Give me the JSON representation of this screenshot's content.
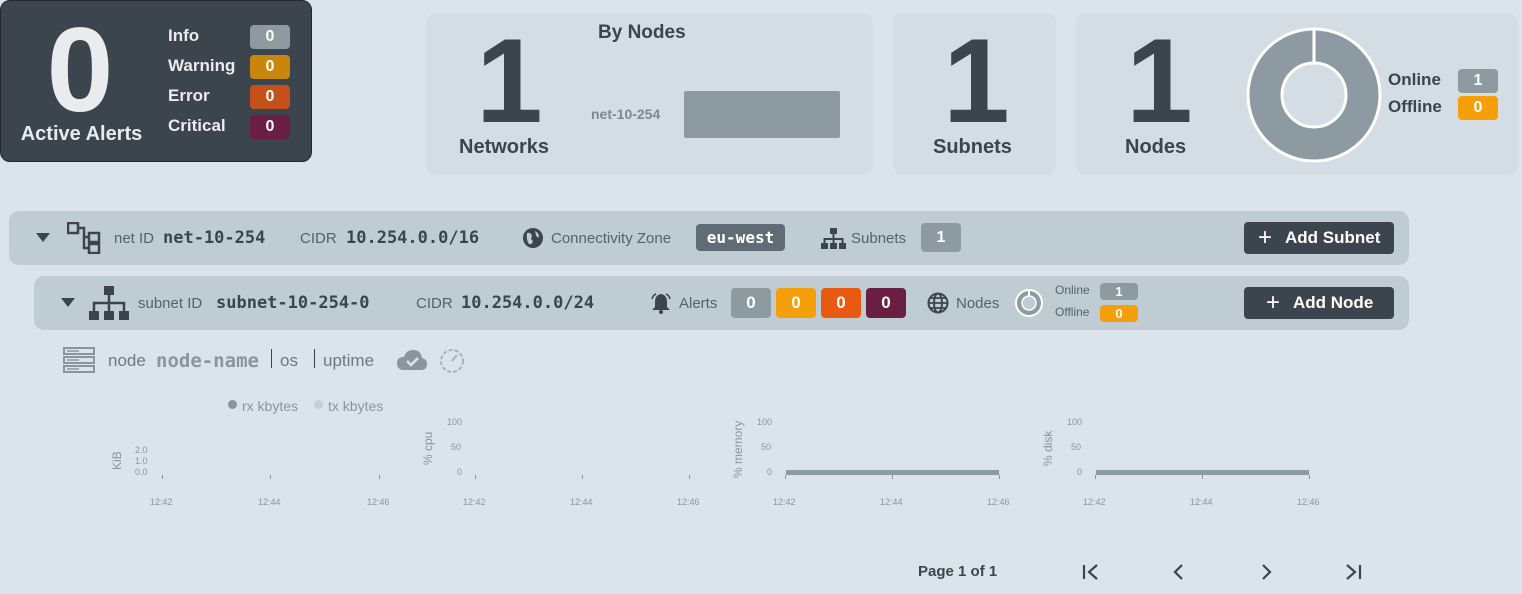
{
  "alerts": {
    "count": "0",
    "label": "Active Alerts",
    "severities": [
      {
        "label": "Info",
        "value": "0",
        "color": "#8d9aa2"
      },
      {
        "label": "Warning",
        "value": "0",
        "color": "#c8860c"
      },
      {
        "label": "Error",
        "value": "0",
        "color": "#c4501a"
      },
      {
        "label": "Critical",
        "value": "0",
        "color": "#6a1e42"
      }
    ]
  },
  "networks": {
    "count": "1",
    "label": "Networks",
    "chart_title": "By Nodes",
    "chart_data": {
      "type": "bar",
      "title": "By Nodes",
      "categories": [
        "net-10-254"
      ],
      "values": [
        1
      ],
      "orientation": "horizontal"
    }
  },
  "subnets": {
    "count": "1",
    "label": "Subnets"
  },
  "nodes": {
    "count": "1",
    "label": "Nodes",
    "online_label": "Online",
    "online_value": "1",
    "offline_label": "Offline",
    "offline_value": "0",
    "chart_data": {
      "type": "pie",
      "categories": [
        "Online",
        "Offline"
      ],
      "values": [
        1,
        0
      ]
    }
  },
  "network_row": {
    "id_label": "net ID",
    "id_value": "net-10-254",
    "cidr_label": "CIDR",
    "cidr_value": "10.254.0.0/16",
    "zone_label": "Connectivity Zone",
    "zone_value": "eu-west",
    "subnets_label": "Subnets",
    "subnets_value": "1",
    "add_button": "Add Subnet"
  },
  "subnet_row": {
    "id_label": "subnet ID",
    "id_value": "subnet-10-254-0",
    "cidr_label": "CIDR",
    "cidr_value": "10.254.0.0/24",
    "alerts_label": "Alerts",
    "alert_values": [
      "0",
      "0",
      "0",
      "0"
    ],
    "nodes_label": "Nodes",
    "online_label": "Online",
    "online_value": "1",
    "offline_label": "Offline",
    "offline_value": "0",
    "add_button": "Add Node"
  },
  "node_row": {
    "node_label": "node",
    "node_name": "node-name",
    "os": "os",
    "uptime": "uptime"
  },
  "charts": {
    "legend": [
      "rx kbytes",
      "tx kbytes"
    ],
    "chart_data": [
      {
        "type": "line",
        "ylabel": "KiB",
        "yticks": [
          "2.0",
          "1.0",
          "0.0"
        ],
        "x": [
          "12:42",
          "12:44",
          "12:46"
        ],
        "series": [
          {
            "name": "rx kbytes",
            "values": []
          },
          {
            "name": "tx kbytes",
            "values": []
          }
        ]
      },
      {
        "type": "line",
        "ylabel": "% cpu",
        "yticks": [
          "100",
          "50",
          "0"
        ],
        "x": [
          "12:42",
          "12:44",
          "12:46"
        ],
        "series": []
      },
      {
        "type": "area",
        "ylabel": "% memory",
        "yticks": [
          "100",
          "50",
          "0"
        ],
        "x": [
          "12:42",
          "12:44",
          "12:46"
        ],
        "values": [
          20,
          20
        ]
      },
      {
        "type": "area",
        "ylabel": "% disk",
        "yticks": [
          "100",
          "50",
          "0"
        ],
        "x": [
          "12:42",
          "12:44",
          "12:46"
        ],
        "values": [
          20,
          20
        ]
      }
    ]
  },
  "pagination": {
    "label": "Page 1 of 1"
  }
}
